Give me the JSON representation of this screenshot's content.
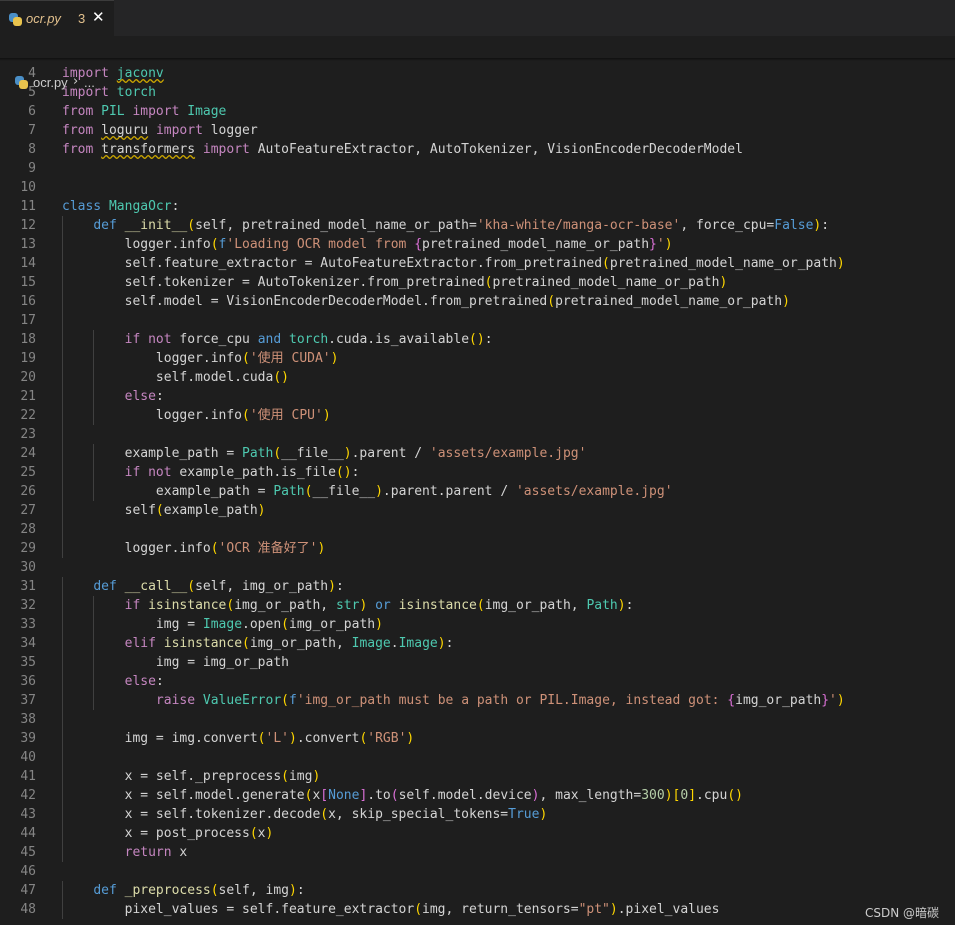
{
  "tab": {
    "filename": "ocr.py",
    "problems_count": "3",
    "close_glyph": "✕"
  },
  "breadcrumb": {
    "file": "ocr.py",
    "separator": "›",
    "more": "..."
  },
  "watermark": "CSDN @暗碳",
  "colors": {
    "keyword": "#569cd6",
    "control": "#c586c0",
    "class": "#4ec9b0",
    "function": "#dcdcaa",
    "variable": "#9cdcfe",
    "string": "#ce9178",
    "number": "#b5cea8",
    "default": "#d4d4d4",
    "line_number": "#858585",
    "background": "#1e1e1e",
    "tab_modified": "#e2c08d"
  },
  "code_lines": [
    {
      "n": 4,
      "guides": 0,
      "t": [
        [
          "import ",
          "ctl"
        ],
        [
          "jaconv",
          "cls squig"
        ]
      ]
    },
    {
      "n": 5,
      "guides": 0,
      "t": [
        [
          "import ",
          "ctl"
        ],
        [
          "torch",
          "cls"
        ]
      ]
    },
    {
      "n": 6,
      "guides": 0,
      "t": [
        [
          "from ",
          "ctl"
        ],
        [
          "PIL ",
          "cls"
        ],
        [
          "import ",
          "ctl"
        ],
        [
          "Image",
          "cls"
        ]
      ]
    },
    {
      "n": 7,
      "guides": 0,
      "t": [
        [
          "from ",
          "ctl"
        ],
        [
          "loguru",
          "squig"
        ],
        [
          " "
        ],
        [
          "import ",
          "ctl"
        ],
        [
          "logger"
        ]
      ]
    },
    {
      "n": 8,
      "guides": 0,
      "t": [
        [
          "from ",
          "ctl"
        ],
        [
          "transformers",
          "squig"
        ],
        [
          " "
        ],
        [
          "import ",
          "ctl"
        ],
        [
          "AutoFeatureExtractor, AutoTokenizer, VisionEncoderDecoderModel"
        ]
      ]
    },
    {
      "n": 9,
      "guides": 0,
      "t": []
    },
    {
      "n": 10,
      "guides": 0,
      "t": []
    },
    {
      "n": 11,
      "guides": 0,
      "t": [
        [
          "class ",
          "kw"
        ],
        [
          "MangaOcr",
          "cls"
        ],
        [
          ":"
        ]
      ]
    },
    {
      "n": 12,
      "guides": 1,
      "t": [
        [
          "    "
        ],
        [
          "def ",
          "kw"
        ],
        [
          "__init__",
          "fn"
        ],
        [
          "(",
          "br1"
        ],
        [
          "self, pretrained_model_name_or_path="
        ],
        [
          "'kha-white/manga-ocr-base'",
          "str"
        ],
        [
          ", force_cpu="
        ],
        [
          "False",
          "kw"
        ],
        [
          ")",
          "br1"
        ],
        [
          ":"
        ]
      ]
    },
    {
      "n": 13,
      "guides": 1,
      "t": [
        [
          "        logger.info"
        ],
        [
          "(",
          "br1"
        ],
        [
          "f",
          "kw"
        ],
        [
          "'Loading OCR model from ",
          "str"
        ],
        [
          "{",
          "br2"
        ],
        [
          "pretrained_model_name_or_path"
        ],
        [
          "}",
          "br2"
        ],
        [
          "'",
          "str"
        ],
        [
          ")",
          "br1"
        ]
      ]
    },
    {
      "n": 14,
      "guides": 1,
      "t": [
        [
          "        self.feature_extractor = AutoFeatureExtractor.from_pretrained"
        ],
        [
          "(",
          "br1"
        ],
        [
          "pretrained_model_name_or_path"
        ],
        [
          ")",
          "br1"
        ]
      ]
    },
    {
      "n": 15,
      "guides": 1,
      "t": [
        [
          "        self.tokenizer = AutoTokenizer.from_pretrained"
        ],
        [
          "(",
          "br1"
        ],
        [
          "pretrained_model_name_or_path"
        ],
        [
          ")",
          "br1"
        ]
      ]
    },
    {
      "n": 16,
      "guides": 1,
      "t": [
        [
          "        self.model = VisionEncoderDecoderModel.from_pretrained"
        ],
        [
          "(",
          "br1"
        ],
        [
          "pretrained_model_name_or_path"
        ],
        [
          ")",
          "br1"
        ]
      ]
    },
    {
      "n": 17,
      "guides": 1,
      "t": []
    },
    {
      "n": 18,
      "guides": 2,
      "t": [
        [
          "        "
        ],
        [
          "if not ",
          "ctl"
        ],
        [
          "force_cpu "
        ],
        [
          "and ",
          "kw"
        ],
        [
          "torch",
          "cls"
        ],
        [
          ".cuda.is_available"
        ],
        [
          "()",
          "br1"
        ],
        [
          ":"
        ]
      ]
    },
    {
      "n": 19,
      "guides": 2,
      "t": [
        [
          "            logger.info"
        ],
        [
          "(",
          "br1"
        ],
        [
          "'使用 CUDA'",
          "str"
        ],
        [
          ")",
          "br1"
        ]
      ]
    },
    {
      "n": 20,
      "guides": 2,
      "t": [
        [
          "            self.model.cuda"
        ],
        [
          "()",
          "br1"
        ]
      ]
    },
    {
      "n": 21,
      "guides": 2,
      "t": [
        [
          "        "
        ],
        [
          "else",
          "ctl"
        ],
        [
          ":"
        ]
      ]
    },
    {
      "n": 22,
      "guides": 2,
      "t": [
        [
          "            logger.info"
        ],
        [
          "(",
          "br1"
        ],
        [
          "'使用 CPU'",
          "str"
        ],
        [
          ")",
          "br1"
        ]
      ]
    },
    {
      "n": 23,
      "guides": 1,
      "t": []
    },
    {
      "n": 24,
      "guides": 2,
      "t": [
        [
          "        example_path = "
        ],
        [
          "Path",
          "cls"
        ],
        [
          "(",
          "br1"
        ],
        [
          "__file__"
        ],
        [
          ")",
          "br1"
        ],
        [
          ".parent / "
        ],
        [
          "'assets/example.jpg'",
          "str"
        ]
      ]
    },
    {
      "n": 25,
      "guides": 2,
      "t": [
        [
          "        "
        ],
        [
          "if not ",
          "ctl"
        ],
        [
          "example_path.is_file"
        ],
        [
          "()",
          "br1"
        ],
        [
          ":"
        ]
      ]
    },
    {
      "n": 26,
      "guides": 2,
      "t": [
        [
          "            example_path = "
        ],
        [
          "Path",
          "cls"
        ],
        [
          "(",
          "br1"
        ],
        [
          "__file__"
        ],
        [
          ")",
          "br1"
        ],
        [
          ".parent.parent / "
        ],
        [
          "'assets/example.jpg'",
          "str"
        ]
      ]
    },
    {
      "n": 27,
      "guides": 1,
      "t": [
        [
          "        self"
        ],
        [
          "(",
          "br1"
        ],
        [
          "example_path"
        ],
        [
          ")",
          "br1"
        ]
      ]
    },
    {
      "n": 28,
      "guides": 1,
      "t": []
    },
    {
      "n": 29,
      "guides": 1,
      "t": [
        [
          "        logger.info"
        ],
        [
          "(",
          "br1"
        ],
        [
          "'OCR 准备好了'",
          "str"
        ],
        [
          ")",
          "br1"
        ]
      ]
    },
    {
      "n": 30,
      "guides": 0,
      "t": []
    },
    {
      "n": 31,
      "guides": 1,
      "t": [
        [
          "    "
        ],
        [
          "def ",
          "kw"
        ],
        [
          "__call__",
          "fn"
        ],
        [
          "(",
          "br1"
        ],
        [
          "self, img_or_path"
        ],
        [
          ")",
          "br1"
        ],
        [
          ":"
        ]
      ]
    },
    {
      "n": 32,
      "guides": 2,
      "t": [
        [
          "        "
        ],
        [
          "if ",
          "ctl"
        ],
        [
          "isinstance",
          "fn"
        ],
        [
          "(",
          "br1"
        ],
        [
          "img_or_path, "
        ],
        [
          "str",
          "cls"
        ],
        [
          ")",
          "br1"
        ],
        [
          " "
        ],
        [
          "or ",
          "kw"
        ],
        [
          "isinstance",
          "fn"
        ],
        [
          "(",
          "br1"
        ],
        [
          "img_or_path, "
        ],
        [
          "Path",
          "cls"
        ],
        [
          ")",
          "br1"
        ],
        [
          ":"
        ]
      ]
    },
    {
      "n": 33,
      "guides": 2,
      "t": [
        [
          "            img = "
        ],
        [
          "Image",
          "cls"
        ],
        [
          ".open"
        ],
        [
          "(",
          "br1"
        ],
        [
          "img_or_path"
        ],
        [
          ")",
          "br1"
        ]
      ]
    },
    {
      "n": 34,
      "guides": 2,
      "t": [
        [
          "        "
        ],
        [
          "elif ",
          "ctl"
        ],
        [
          "isinstance",
          "fn"
        ],
        [
          "(",
          "br1"
        ],
        [
          "img_or_path, "
        ],
        [
          "Image",
          "cls"
        ],
        [
          "."
        ],
        [
          "Image",
          "cls"
        ],
        [
          ")",
          "br1"
        ],
        [
          ":"
        ]
      ]
    },
    {
      "n": 35,
      "guides": 2,
      "t": [
        [
          "            img = img_or_path"
        ]
      ]
    },
    {
      "n": 36,
      "guides": 2,
      "t": [
        [
          "        "
        ],
        [
          "else",
          "ctl"
        ],
        [
          ":"
        ]
      ]
    },
    {
      "n": 37,
      "guides": 2,
      "t": [
        [
          "            "
        ],
        [
          "raise ",
          "ctl"
        ],
        [
          "ValueError",
          "cls"
        ],
        [
          "(",
          "br1"
        ],
        [
          "f",
          "kw"
        ],
        [
          "'img_or_path must be a path or PIL.Image, instead got: ",
          "str"
        ],
        [
          "{",
          "br2"
        ],
        [
          "img_or_path"
        ],
        [
          "}",
          "br2"
        ],
        [
          "'",
          "str"
        ],
        [
          ")",
          "br1"
        ]
      ]
    },
    {
      "n": 38,
      "guides": 1,
      "t": []
    },
    {
      "n": 39,
      "guides": 1,
      "t": [
        [
          "        img = img.convert"
        ],
        [
          "(",
          "br1"
        ],
        [
          "'L'",
          "str"
        ],
        [
          ")",
          "br1"
        ],
        [
          ".convert"
        ],
        [
          "(",
          "br1"
        ],
        [
          "'RGB'",
          "str"
        ],
        [
          ")",
          "br1"
        ]
      ]
    },
    {
      "n": 40,
      "guides": 1,
      "t": []
    },
    {
      "n": 41,
      "guides": 1,
      "t": [
        [
          "        x = self._preprocess"
        ],
        [
          "(",
          "br1"
        ],
        [
          "img"
        ],
        [
          ")",
          "br1"
        ]
      ]
    },
    {
      "n": 42,
      "guides": 1,
      "t": [
        [
          "        x = self.model.generate"
        ],
        [
          "(",
          "br1"
        ],
        [
          "x"
        ],
        [
          "[",
          "br2"
        ],
        [
          "None",
          "kw"
        ],
        [
          "]",
          "br2"
        ],
        [
          ".to"
        ],
        [
          "(",
          "br2"
        ],
        [
          "self.model.device"
        ],
        [
          ")",
          "br2"
        ],
        [
          ", max_length="
        ],
        [
          "300",
          "num"
        ],
        [
          ")",
          "br1"
        ],
        [
          "[",
          "br1"
        ],
        [
          "0",
          "num"
        ],
        [
          "]",
          "br1"
        ],
        [
          ".cpu"
        ],
        [
          "()",
          "br1"
        ]
      ]
    },
    {
      "n": 43,
      "guides": 1,
      "t": [
        [
          "        x = self.tokenizer.decode"
        ],
        [
          "(",
          "br1"
        ],
        [
          "x, skip_special_tokens="
        ],
        [
          "True",
          "kw"
        ],
        [
          ")",
          "br1"
        ]
      ]
    },
    {
      "n": 44,
      "guides": 1,
      "t": [
        [
          "        x = post_process"
        ],
        [
          "(",
          "br1"
        ],
        [
          "x"
        ],
        [
          ")",
          "br1"
        ]
      ]
    },
    {
      "n": 45,
      "guides": 1,
      "t": [
        [
          "        "
        ],
        [
          "return ",
          "ctl"
        ],
        [
          "x"
        ]
      ]
    },
    {
      "n": 46,
      "guides": 0,
      "t": []
    },
    {
      "n": 47,
      "guides": 1,
      "t": [
        [
          "    "
        ],
        [
          "def ",
          "kw"
        ],
        [
          "_preprocess",
          "fn"
        ],
        [
          "(",
          "br1"
        ],
        [
          "self, img"
        ],
        [
          ")",
          "br1"
        ],
        [
          ":"
        ]
      ]
    },
    {
      "n": 48,
      "guides": 1,
      "t": [
        [
          "        pixel_values = self.feature_extractor"
        ],
        [
          "(",
          "br1"
        ],
        [
          "img, return_tensors="
        ],
        [
          "\"pt\"",
          "str"
        ],
        [
          ")",
          "br1"
        ],
        [
          ".pixel_values"
        ]
      ]
    }
  ]
}
